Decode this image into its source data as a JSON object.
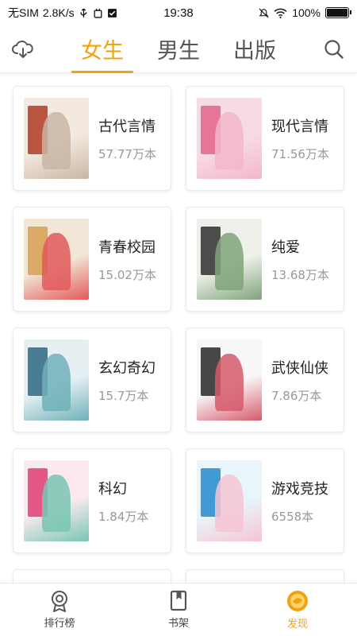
{
  "status_bar": {
    "carrier": "无SIM",
    "speed": "2.8K/s",
    "time": "19:38",
    "battery_text": "100%",
    "battery_level": 1.0
  },
  "header": {
    "tabs": [
      {
        "label": "女生",
        "active": true
      },
      {
        "label": "男生",
        "active": false
      },
      {
        "label": "出版",
        "active": false
      }
    ],
    "left_icon": "cloud-download-icon",
    "right_icon": "search-icon"
  },
  "categories": [
    {
      "name": "古代言情",
      "count": "57.77万本",
      "cover_colors": [
        "#f4e9df",
        "#b5442f",
        "#c8b6a4"
      ]
    },
    {
      "name": "现代言情",
      "count": "71.56万本",
      "cover_colors": [
        "#f7dbe4",
        "#e26a8f",
        "#f3b7c9"
      ]
    },
    {
      "name": "青春校园",
      "count": "15.02万本",
      "cover_colors": [
        "#f2e6d6",
        "#d9a35a",
        "#e15a5a"
      ]
    },
    {
      "name": "纯爱",
      "count": "13.68万本",
      "cover_colors": [
        "#eef0ea",
        "#3a3a3a",
        "#7fa37a"
      ]
    },
    {
      "name": "玄幻奇幻",
      "count": "15.7万本",
      "cover_colors": [
        "#e6f0f3",
        "#3a6f8c",
        "#6fb0b8"
      ]
    },
    {
      "name": "武侠仙侠",
      "count": "7.86万本",
      "cover_colors": [
        "#f7f7f7",
        "#333333",
        "#d65a6a"
      ]
    },
    {
      "name": "科幻",
      "count": "1.84万本",
      "cover_colors": [
        "#fbe9ef",
        "#e2477a",
        "#78c6b3"
      ]
    },
    {
      "name": "游戏竞技",
      "count": "6558本",
      "cover_colors": [
        "#e8f5fb",
        "#2f8fd1",
        "#f6c4d3"
      ]
    }
  ],
  "bottom_nav": [
    {
      "label": "排行榜",
      "icon": "medal-icon",
      "active": false
    },
    {
      "label": "书架",
      "icon": "bookshelf-icon",
      "active": false
    },
    {
      "label": "发现",
      "icon": "discover-icon",
      "active": true
    }
  ],
  "colors": {
    "accent": "#f2a20e"
  }
}
